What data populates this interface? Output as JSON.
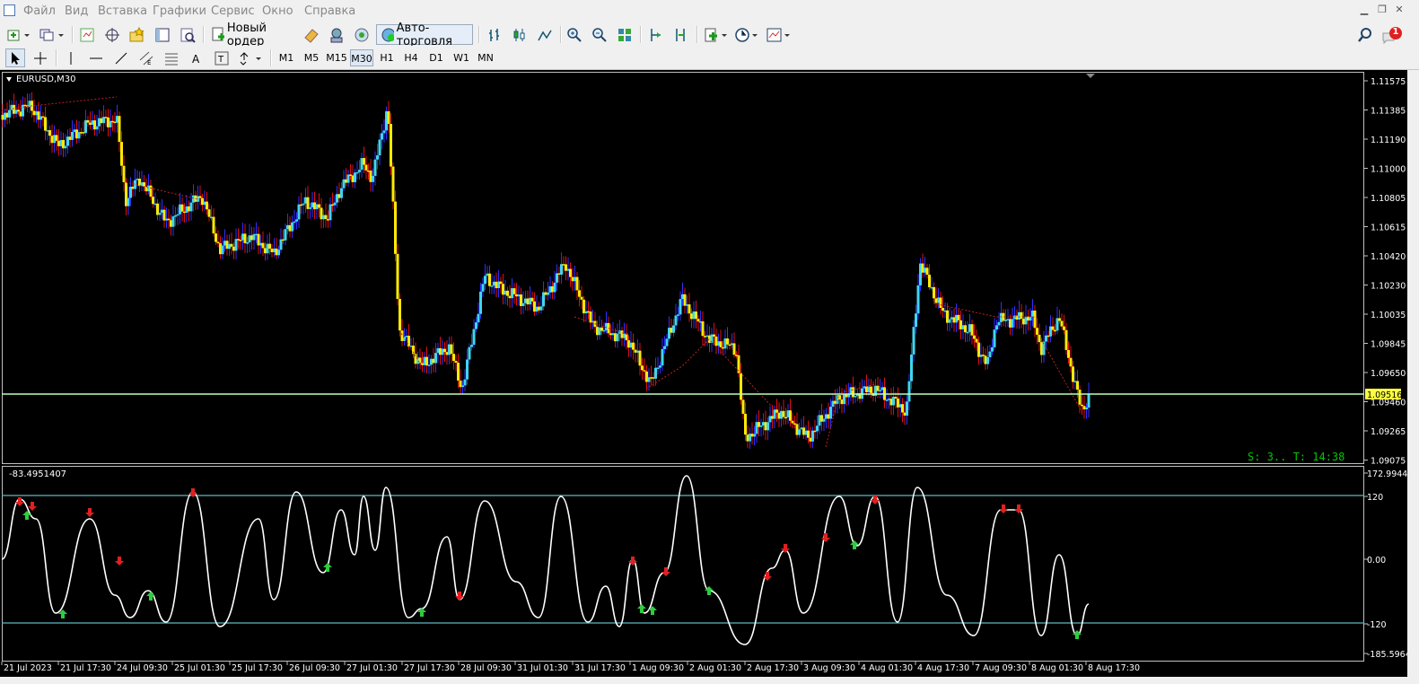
{
  "menu": [
    "Файл",
    "Вид",
    "Вставка",
    "Графики",
    "Сервис",
    "Окно",
    "Справка"
  ],
  "toolbar": {
    "new_order": "Новый ордер",
    "algo_trading": "Авто-торговля",
    "timeframes": [
      "M1",
      "M5",
      "M15",
      "M30",
      "H1",
      "H4",
      "D1",
      "W1",
      "MN"
    ],
    "active_timeframe": "M30",
    "notification_count": "1"
  },
  "chart": {
    "symbol_label": "EURUSD,M30",
    "price_labels": [
      "1.11575",
      "1.11385",
      "1.11190",
      "1.11000",
      "1.10805",
      "1.10615",
      "1.10420",
      "1.10230",
      "1.10035",
      "1.09845",
      "1.09650",
      "1.09460",
      "1.09265",
      "1.09075"
    ],
    "current_price": "1.09516",
    "status_text": "S: 3.. T: 14:38",
    "time_labels": [
      "21 Jul 2023",
      "21 Jul 17:30",
      "24 Jul 09:30",
      "25 Jul 01:30",
      "25 Jul 17:30",
      "26 Jul 09:30",
      "27 Jul 01:30",
      "27 Jul 17:30",
      "28 Jul 09:30",
      "31 Jul 01:30",
      "31 Jul 17:30",
      "1 Aug 09:30",
      "2 Aug 01:30",
      "2 Aug 17:30",
      "3 Aug 09:30",
      "4 Aug 01:30",
      "4 Aug 17:30",
      "7 Aug 09:30",
      "8 Aug 01:30",
      "8 Aug 17:30"
    ],
    "colors": {
      "bull": "#3fd6f2",
      "bear": "#ffea00",
      "wick_up": "#3030ff",
      "wick_down": "#e01010",
      "level": "#b8ffb8",
      "indicator_line": "#ffffff",
      "indicator_level": "#5fb8c4",
      "arrow_up": "#2ecc40",
      "arrow_down": "#e02020",
      "status": "#00c800"
    }
  },
  "indicator": {
    "value_label": "-83.4951407",
    "scale_labels": [
      "172.99448",
      "120",
      "0.00",
      "-120",
      "-185.5964"
    ]
  }
}
